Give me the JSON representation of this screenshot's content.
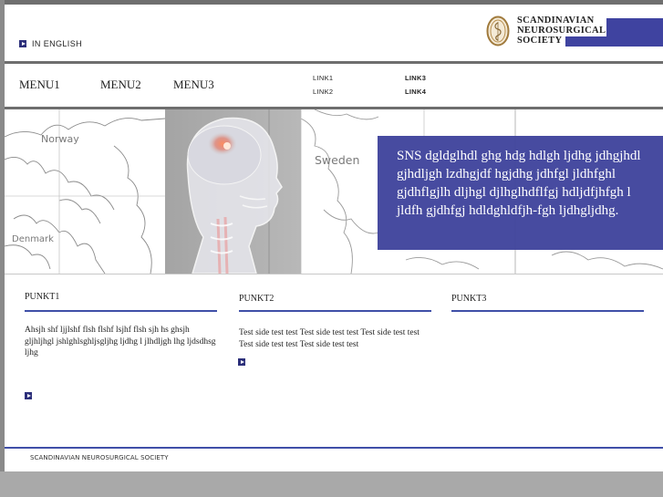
{
  "header": {
    "language_link": "IN ENGLISH",
    "logo_lines": [
      "SCANDINAVIAN",
      "NEUROSURGICAL",
      "SOCIETY"
    ],
    "brand_color": "#3f43a0"
  },
  "nav": {
    "menus": [
      "MENU1",
      "MENU2",
      "MENU3"
    ],
    "links": [
      "LINK1",
      "LINK2",
      "LINK3",
      "LINK4"
    ]
  },
  "hero": {
    "map_labels": [
      "Norway",
      "Sweden",
      "Denmark"
    ],
    "overlay_text": "SNS dgldglhdl ghg hdg hdlgh ljdhg jdhgjhdl gjhdljgh lzdhgjdf hgjdhg jdhfgl jldhfghl gjdhflgjlh dljhgl djlhglhdflfgj hdljdfjhfgh l jldfh gjdhfgj hdldghldfjh-fgh ljdhgljdhg.",
    "overlay_color": "#3d419b"
  },
  "columns": [
    {
      "title": "PUNKT1",
      "text": "Ahsjh  shf ljjlshf flsh  flshf lsjhf flsh sjh  hs ghsjh gljhljhgl jshlghlsghljsgljhg ljdhg l jlhdljgh lhg ljdsdhsg ljhg"
    },
    {
      "title": "PUNKT2",
      "text": "Test side test test Test side test test Test side test test Test side test test Test side test test"
    },
    {
      "title": "PUNKT3",
      "text": ""
    }
  ],
  "footer": {
    "text": "SCANDINAVIAN NEUROSURGICAL SOCIETY"
  }
}
